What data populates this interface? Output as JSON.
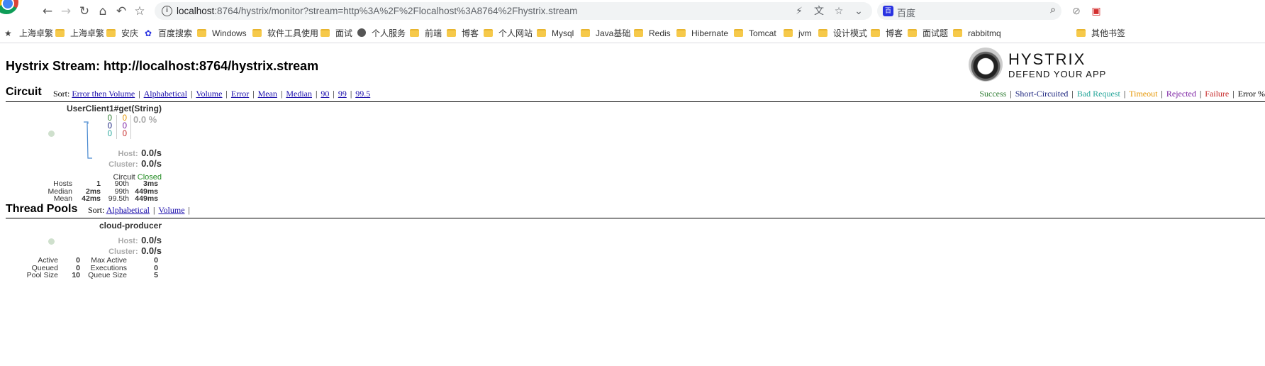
{
  "browser": {
    "url_host": "localhost",
    "url_rest": ":8764/hystrix/monitor?stream=http%3A%2F%2Flocalhost%3A8764%2Fhystrix.stream",
    "search_placeholder": "百度",
    "bookmarks": [
      "上海卓繁",
      "上海卓繁",
      "安庆",
      "百度搜索",
      "Windows",
      "软件工具使用",
      "面试",
      "个人服务",
      "前端",
      "博客",
      "个人网站",
      "Mysql",
      "Java基础",
      "Redis",
      "Hibernate",
      "Tomcat",
      "jvm",
      "设计模式",
      "博客",
      "面试题",
      "rabbitmq",
      "其他书签"
    ]
  },
  "page": {
    "title": "Hystrix Stream: http://localhost:8764/hystrix.stream",
    "logo": {
      "wordmark": "HYSTRIX",
      "tagline": "DEFEND YOUR APP"
    }
  },
  "circuit_section": {
    "heading": "Circuit",
    "sort_label": "Sort:",
    "sort_options": [
      "Error then Volume",
      "Alphabetical",
      "Volume",
      "Error",
      "Mean",
      "Median",
      "90",
      "99",
      "99.5"
    ],
    "legend": [
      {
        "label": "Success",
        "color": "#2e7d32"
      },
      {
        "label": "Short-Circuited",
        "color": "#1a237e"
      },
      {
        "label": "Bad Request",
        "color": "#26a69a"
      },
      {
        "label": "Timeout",
        "color": "#e69500"
      },
      {
        "label": "Rejected",
        "color": "#7b1fa2"
      },
      {
        "label": "Failure",
        "color": "#c62828"
      },
      {
        "label": "Error %",
        "color": "#000000"
      }
    ]
  },
  "circuit": {
    "name": "UserClient1#get(String)",
    "counts_left": [
      "0",
      "0",
      "0"
    ],
    "counts_left_colors": [
      "#2e7d32",
      "#1a237e",
      "#26a69a"
    ],
    "counts_right": [
      "0",
      "0",
      "0"
    ],
    "counts_right_colors": [
      "#e69500",
      "#7b1fa2",
      "#c62828"
    ],
    "error_pct": "0.0 %",
    "host_label": "Host:",
    "host_rate": "0.0/s",
    "cluster_label": "Cluster:",
    "cluster_rate": "0.0/s",
    "circuit_label": "Circuit",
    "circuit_status": "Closed",
    "stats": {
      "hosts_label": "Hosts",
      "hosts": "1",
      "median_label": "Median",
      "median": "2ms",
      "mean_label": "Mean",
      "mean": "42ms",
      "p90_label": "90th",
      "p90": "3ms",
      "p99_label": "99th",
      "p99": "449ms",
      "p995_label": "99.5th",
      "p995": "449ms"
    }
  },
  "thread_section": {
    "heading": "Thread Pools",
    "sort_label": "Sort:",
    "sort_options": [
      "Alphabetical",
      "Volume"
    ]
  },
  "thread_pool": {
    "name": "cloud-producer",
    "host_label": "Host:",
    "host_rate": "0.0/s",
    "cluster_label": "Cluster:",
    "cluster_rate": "0.0/s",
    "stats": {
      "active_label": "Active",
      "active": "0",
      "queued_label": "Queued",
      "queued": "0",
      "pool_size_label": "Pool Size",
      "pool_size": "10",
      "max_active_label": "Max Active",
      "max_active": "0",
      "executions_label": "Executions",
      "executions": "0",
      "queue_size_label": "Queue Size",
      "queue_size": "5"
    }
  }
}
